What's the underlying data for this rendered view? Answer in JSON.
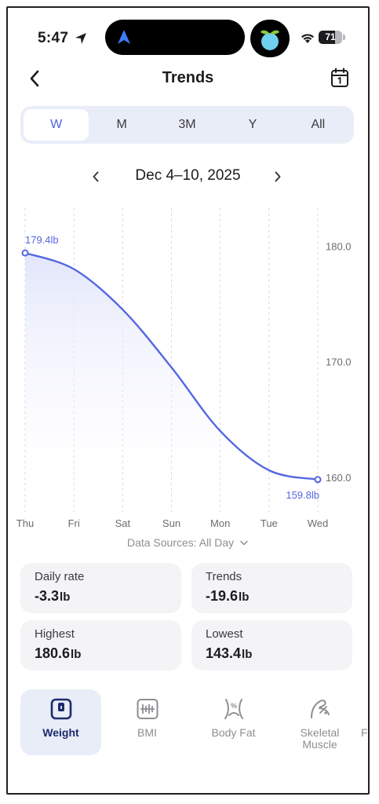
{
  "status_bar": {
    "time": "5:47",
    "battery": "71",
    "battery_level": 0.71
  },
  "nav": {
    "title": "Trends"
  },
  "ranges": [
    {
      "label": "W",
      "active": true
    },
    {
      "label": "M",
      "active": false
    },
    {
      "label": "3M",
      "active": false
    },
    {
      "label": "Y",
      "active": false
    },
    {
      "label": "All",
      "active": false
    }
  ],
  "date_range": "Dec 4–10, 2025",
  "chart_data": {
    "type": "line",
    "x": [
      "Thu",
      "Fri",
      "Sat",
      "Sun",
      "Mon",
      "Tue",
      "Wed"
    ],
    "y_ticks": [
      "180.0",
      "170.0",
      "160.0"
    ],
    "ylim": [
      157.0,
      184.3
    ],
    "start": {
      "x": "Thu",
      "y": 179.4,
      "label": "179.4lb"
    },
    "end": {
      "x": "Wed",
      "y": 159.8,
      "label": "159.8lb"
    },
    "series": [
      {
        "values": [
          179.4,
          178.0,
          174.5,
          169.5,
          164.0,
          160.6,
          159.8
        ]
      }
    ],
    "grid": "vertical dashed",
    "line_color": "#5567e0"
  },
  "data_sources": "Data Sources: All Day",
  "stats": {
    "daily_rate": {
      "label": "Daily rate",
      "value": "-3.3",
      "unit": "lb"
    },
    "trends": {
      "label": "Trends",
      "value": "-19.6",
      "unit": "lb"
    },
    "highest": {
      "label": "Highest",
      "value": "180.6",
      "unit": "lb"
    },
    "lowest": {
      "label": "Lowest",
      "value": "143.4",
      "unit": "lb"
    }
  },
  "metrics": [
    {
      "label": "Weight",
      "icon": "weight-scale-icon",
      "active": true
    },
    {
      "label": "BMI",
      "icon": "bmi-ruler-icon",
      "active": false
    },
    {
      "label": "Body Fat",
      "icon": "body-fat-icon",
      "active": false
    },
    {
      "label": "Skeletal\nMuscle",
      "icon": "skeletal-muscle-icon",
      "active": false
    },
    {
      "label": "F",
      "icon": "",
      "active": false
    }
  ],
  "colors": {
    "accent": "#4b63e0",
    "segment_bg": "#e9edf8",
    "card_bg": "#f4f4f6"
  }
}
